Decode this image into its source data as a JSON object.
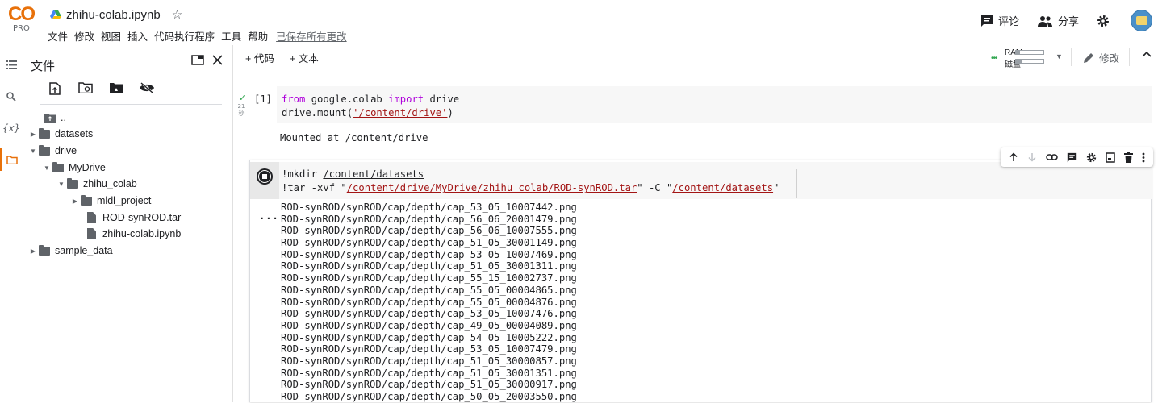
{
  "header": {
    "logo_text": "CO",
    "plan": "PRO",
    "notebook_title": "zhihu-colab.ipynb",
    "menu": [
      "文件",
      "修改",
      "视图",
      "插入",
      "代码执行程序",
      "工具",
      "帮助"
    ],
    "saved_status": "已保存所有更改",
    "comment_label": "评论",
    "share_label": "分享"
  },
  "files": {
    "title": "文件",
    "tree": [
      {
        "label": "..",
        "type": "up"
      },
      {
        "label": "datasets",
        "type": "folder",
        "expanded": false
      },
      {
        "label": "drive",
        "type": "folder",
        "expanded": true
      },
      {
        "label": "MyDrive",
        "type": "folder",
        "expanded": true
      },
      {
        "label": "zhihu_colab",
        "type": "folder",
        "expanded": true
      },
      {
        "label": "mldl_project",
        "type": "folder",
        "expanded": false
      },
      {
        "label": "ROD-synROD.tar",
        "type": "file"
      },
      {
        "label": "zhihu-colab.ipynb",
        "type": "file"
      },
      {
        "label": "sample_data",
        "type": "folder",
        "expanded": false
      }
    ]
  },
  "toolbar": {
    "add_code": "+ 代码",
    "add_text": "+ 文本",
    "ram_label": "RAM",
    "disk_label": "磁盘",
    "ram_usage": 0.15,
    "disk_usage": 0.2,
    "edit_label": "修改"
  },
  "cell1": {
    "exec_count": "[1]",
    "elapsed": "21秒",
    "code": {
      "line1": {
        "a": "from",
        "b": " google.colab ",
        "c": "import",
        "d": " drive"
      },
      "line2": {
        "a": "drive.mount(",
        "b": "'/content/drive'",
        "c": ")"
      }
    },
    "output": "Mounted at /content/drive"
  },
  "cell2": {
    "code": {
      "line1": {
        "a": "!mkdir ",
        "b": "/content/datasets"
      },
      "line2": {
        "a": "!tar -xvf \"",
        "b": "/content/drive/MyDrive/zhihu_colab/ROD-synROD.tar",
        "c": "\" -C \"",
        "d": "/content/datasets",
        "e": "\""
      }
    },
    "output_marker": "...",
    "output_lines": [
      "ROD-synROD/synROD/cap/depth/cap_53_05_10007442.png",
      "ROD-synROD/synROD/cap/depth/cap_56_06_20001479.png",
      "ROD-synROD/synROD/cap/depth/cap_56_06_10007555.png",
      "ROD-synROD/synROD/cap/depth/cap_51_05_30001149.png",
      "ROD-synROD/synROD/cap/depth/cap_53_05_10007469.png",
      "ROD-synROD/synROD/cap/depth/cap_51_05_30001311.png",
      "ROD-synROD/synROD/cap/depth/cap_55_15_10002737.png",
      "ROD-synROD/synROD/cap/depth/cap_55_05_00004865.png",
      "ROD-synROD/synROD/cap/depth/cap_55_05_00004876.png",
      "ROD-synROD/synROD/cap/depth/cap_53_05_10007476.png",
      "ROD-synROD/synROD/cap/depth/cap_49_05_00004089.png",
      "ROD-synROD/synROD/cap/depth/cap_54_05_10005222.png",
      "ROD-synROD/synROD/cap/depth/cap_53_05_10007479.png",
      "ROD-synROD/synROD/cap/depth/cap_51_05_30000857.png",
      "ROD-synROD/synROD/cap/depth/cap_51_05_30001351.png",
      "ROD-synROD/synROD/cap/depth/cap_51_05_30000917.png",
      "ROD-synROD/synROD/cap/depth/cap_50_05_20003550.png"
    ]
  },
  "colors": {
    "accent": "#e8710a",
    "logo_yellow": "#f9ab00",
    "keyword": "#af00db",
    "string": "#a31515",
    "success": "#34a853"
  }
}
